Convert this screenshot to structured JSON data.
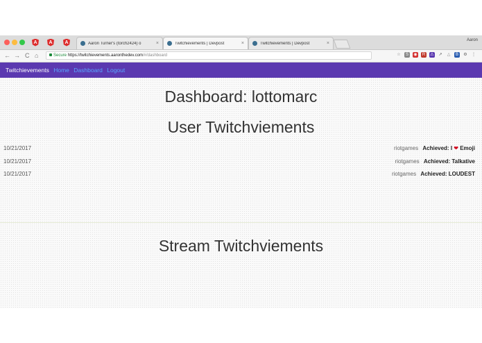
{
  "browser": {
    "pinned_tabs": [
      "A",
      "A",
      "A"
    ],
    "tabs": [
      {
        "title": "Aaron Turner's (torch2424) o",
        "close": "×"
      },
      {
        "title": "Twitchievements | Devpost",
        "close": "×"
      },
      {
        "title": "Twitchievements | Devpost",
        "close": "×"
      }
    ],
    "profile": "Aaron",
    "nav": {
      "back": "←",
      "forward": "→",
      "reload": "C",
      "home": "⌂"
    },
    "url": {
      "secure_label": "Secure",
      "host": "https://twitchievements.aaronthedev.com",
      "path": "/#/dashboard"
    },
    "extensions": [
      "☆",
      "S",
      "◉",
      "R",
      "⚠",
      "↗",
      "△",
      "B",
      "⚙",
      "⋮"
    ]
  },
  "navbar": {
    "brand": "Twitchievements",
    "links": [
      "Home",
      "Dashboard",
      "Logout"
    ]
  },
  "dashboard": {
    "title": "Dashboard: lottomarc",
    "user_section_title": "User Twitchviements",
    "user_achievements": [
      {
        "date": "10/21/2017",
        "user": "riotgames",
        "prefix": "Achieved: I",
        "icon": "❤",
        "suffix": "Emoji"
      },
      {
        "date": "10/21/2017",
        "user": "riotgames",
        "prefix": "Achieved: Talkative",
        "icon": "",
        "suffix": ""
      },
      {
        "date": "10/21/2017",
        "user": "riotgames",
        "prefix": "Achieved: LOUDEST",
        "icon": "",
        "suffix": ""
      }
    ],
    "stream_section_title": "Stream Twitchviements"
  },
  "colors": {
    "navbar_bg": "#5b39b0",
    "link": "#5aa7ff",
    "heart": "#d0021b"
  }
}
